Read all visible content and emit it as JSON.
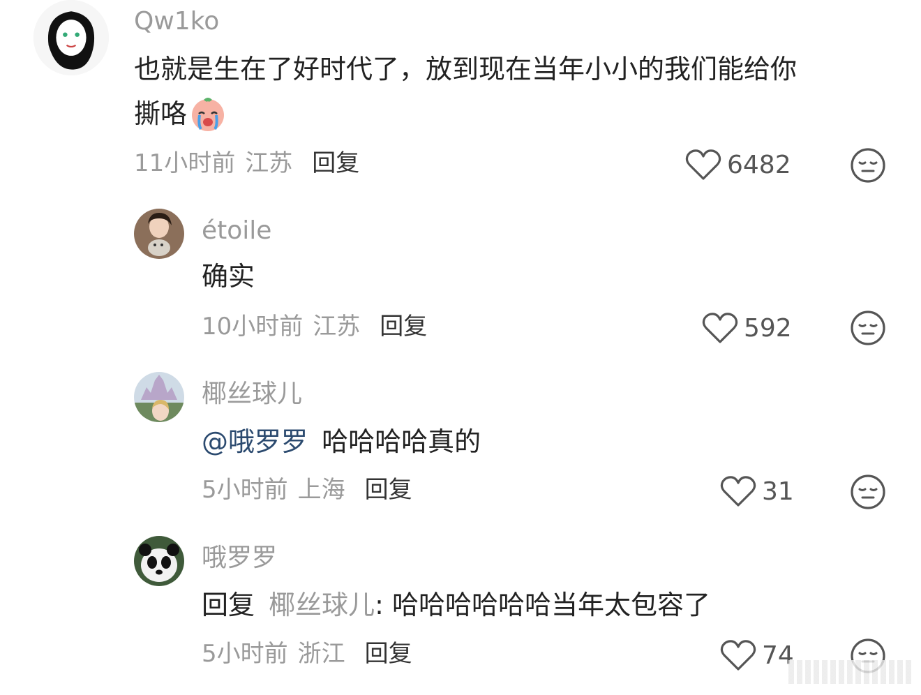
{
  "comments": [
    {
      "username": "Qw1ko",
      "text": "也就是生在了好时代了，放到现在当年小小的我们能给你",
      "text_line2": "撕咯",
      "time": "11小时前",
      "region": "江苏",
      "reply_label": "回复",
      "likes": "6482"
    },
    {
      "username": "étoile",
      "text": "确实",
      "time": "10小时前",
      "region": "江苏",
      "reply_label": "回复",
      "likes": "592"
    },
    {
      "username": "椰丝球儿",
      "mention": "@哦罗罗",
      "text": "哈哈哈哈真的",
      "time": "5小时前",
      "region": "上海",
      "reply_label": "回复",
      "likes": "31"
    },
    {
      "username": "哦罗罗",
      "reply_prefix": "回复",
      "reply_to": "椰丝球儿",
      "text": ": 哈哈哈哈哈哈当年太包容了",
      "time": "5小时前",
      "region": "浙江",
      "reply_label": "回复",
      "likes": "74"
    }
  ],
  "icons": {
    "like": "heart-outline-icon",
    "dislike": "meh-face-icon",
    "emoji": "crying-peach-emoji"
  },
  "colors": {
    "primary_text": "#222222",
    "muted_text": "#9a9a9a",
    "mention": "#2b4a6f"
  }
}
